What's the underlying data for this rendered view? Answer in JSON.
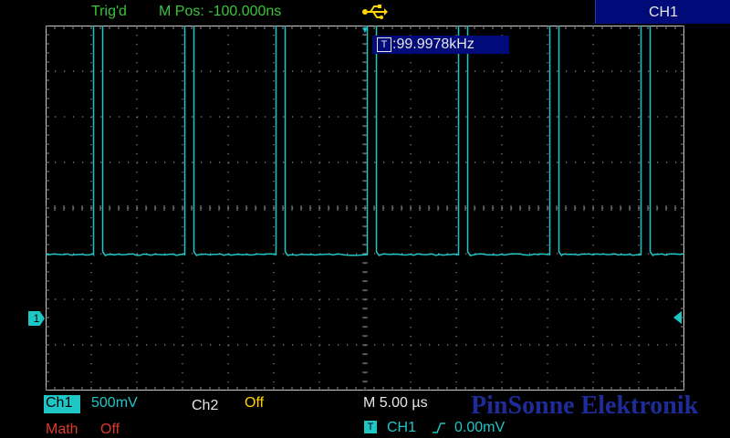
{
  "header": {
    "trigger_status": "Trig'd",
    "horizontal_position": "M Pos: -100.000ns",
    "usb_icon": "usb-icon",
    "channel_label": "CH1"
  },
  "measurement": {
    "badge": "T",
    "frequency": ":99.9978kHz"
  },
  "markers": {
    "ground_marker": "1",
    "trigger_position": "▼"
  },
  "channels": {
    "ch1": {
      "label": "Ch1",
      "scale": "500mV"
    },
    "ch2": {
      "label": "Ch2",
      "state": "Off"
    },
    "math": {
      "label": "Math",
      "state": "Off"
    }
  },
  "timebase": {
    "value": "M 5.00 µs"
  },
  "trigger": {
    "badge": "T",
    "source": "CH1",
    "edge": "rising-edge-icon",
    "level": "0.00mV"
  },
  "watermark": "PinSonne Elektronik",
  "colors": {
    "trace": "#1fc6c6",
    "trig_status": "#3ac53a",
    "math": "#d93a2b",
    "ch2_value": "#ffd400",
    "label_bg": "#000a78",
    "grid_frame": "#cfcfcf"
  },
  "waveform": {
    "type": "pulse",
    "period_divisions": 2,
    "high_width_divisions": 0.2,
    "low_level_divisions": -1.0,
    "high_level_divisions": 4.1,
    "first_rising_edge_divisions": 1.05,
    "horizontal_divisions": 14,
    "vertical_divisions": 8
  }
}
